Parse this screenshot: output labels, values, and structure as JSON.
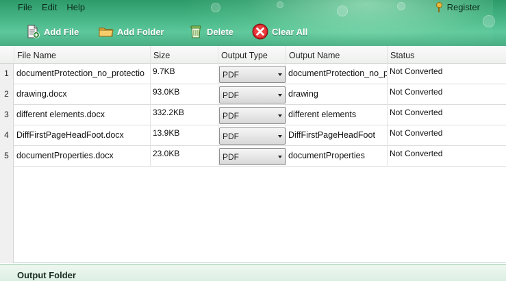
{
  "menu": {
    "items": [
      "File",
      "Edit",
      "Help"
    ],
    "register_label": "Register"
  },
  "toolbar": {
    "add_file": "Add File",
    "add_folder": "Add Folder",
    "delete": "Delete",
    "clear_all": "Clear All"
  },
  "table": {
    "headers": {
      "file_name": "File Name",
      "size": "Size",
      "output_type": "Output Type",
      "output_name": "Output Name",
      "status": "Status"
    },
    "rows": [
      {
        "num": "1",
        "file_name": "documentProtection_no_protectio",
        "size": "9.7KB",
        "output_type": "PDF",
        "output_name": "documentProtection_no_p",
        "status": "Not Converted"
      },
      {
        "num": "2",
        "file_name": "drawing.docx",
        "size": "93.0KB",
        "output_type": "PDF",
        "output_name": "drawing",
        "status": "Not Converted"
      },
      {
        "num": "3",
        "file_name": "different elements.docx",
        "size": "332.2KB",
        "output_type": "PDF",
        "output_name": "different elements",
        "status": "Not Converted"
      },
      {
        "num": "4",
        "file_name": "DiffFirstPageHeadFoot.docx",
        "size": "13.9KB",
        "output_type": "PDF",
        "output_name": "DiffFirstPageHeadFoot",
        "status": "Not Converted"
      },
      {
        "num": "5",
        "file_name": "documentProperties.docx",
        "size": "23.0KB",
        "output_type": "PDF",
        "output_name": "documentProperties",
        "status": "Not Converted"
      }
    ]
  },
  "footer": {
    "label": "Output Folder"
  },
  "colors": {
    "banner": "#49b889",
    "footer": "#dcefe3"
  },
  "icons": [
    "add-file-icon",
    "add-folder-icon",
    "delete-icon",
    "clear-all-icon",
    "key-icon",
    "chevron-down-icon"
  ]
}
